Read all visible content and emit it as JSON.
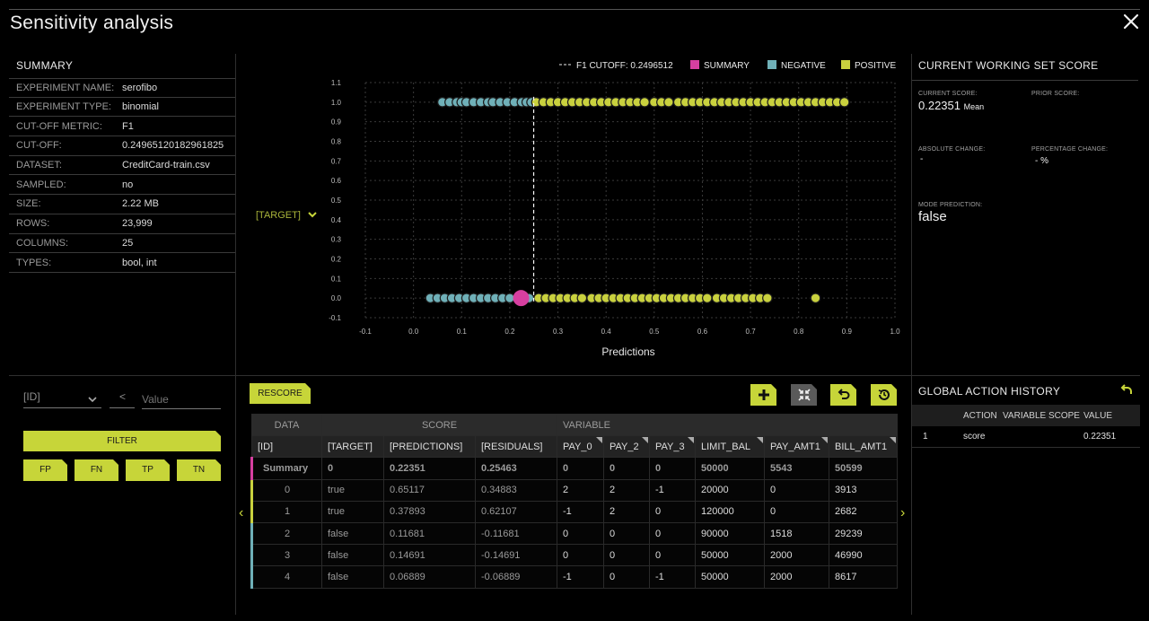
{
  "title": "Sensitivity analysis",
  "summary": {
    "heading": "SUMMARY",
    "rows": [
      {
        "key": "EXPERIMENT NAME:",
        "val": "serofibo"
      },
      {
        "key": "EXPERIMENT TYPE:",
        "val": "binomial"
      },
      {
        "key": "CUT-OFF METRIC:",
        "val": "F1"
      },
      {
        "key": "CUT-OFF:",
        "val": "0.24965120182961825"
      },
      {
        "key": "DATASET:",
        "val": "CreditCard-train.csv"
      },
      {
        "key": "SAMPLED:",
        "val": "no"
      },
      {
        "key": "SIZE:",
        "val": "2.22 MB"
      },
      {
        "key": "ROWS:",
        "val": "23,999"
      },
      {
        "key": "COLUMNS:",
        "val": "25"
      },
      {
        "key": "TYPES:",
        "val": "bool, int"
      }
    ]
  },
  "chart_data": {
    "type": "scatter",
    "xlabel": "Predictions",
    "ylabel_select": "[TARGET]",
    "xlim": [
      -0.1,
      1.0
    ],
    "ylim": [
      -0.1,
      1.1
    ],
    "xticks": [
      "-0.1",
      "0.0",
      "0.1",
      "0.2",
      "0.3",
      "0.4",
      "0.5",
      "0.6",
      "0.7",
      "0.8",
      "0.9",
      "1.0"
    ],
    "yticks": [
      "-0.1",
      "0.0",
      "0.1",
      "0.2",
      "0.3",
      "0.4",
      "0.5",
      "0.6",
      "0.7",
      "0.8",
      "0.9",
      "1.0",
      "1.1"
    ],
    "cutoff": 0.2496512,
    "legend": {
      "cutoff": "F1 CUTOFF: 0.2496512",
      "summary": "SUMMARY",
      "negative": "NEGATIVE",
      "positive": "POSITIVE"
    },
    "colors": {
      "summary": "#d63fa0",
      "negative": "#6fb0b8",
      "positive": "#c9d13e"
    },
    "summary_point": {
      "x": 0.2235,
      "y": 0.0
    },
    "series": [
      {
        "name": "NEGATIVE",
        "y": 1.0,
        "x": [
          0.06,
          0.075,
          0.09,
          0.1,
          0.11,
          0.125,
          0.14,
          0.155,
          0.165,
          0.18,
          0.195,
          0.21,
          0.225,
          0.235,
          0.245
        ]
      },
      {
        "name": "POSITIVE",
        "y": 1.0,
        "x": [
          0.255,
          0.27,
          0.285,
          0.3,
          0.315,
          0.33,
          0.345,
          0.36,
          0.375,
          0.39,
          0.405,
          0.42,
          0.435,
          0.45,
          0.465,
          0.48,
          0.5,
          0.515,
          0.53,
          0.55,
          0.565,
          0.58,
          0.595,
          0.61,
          0.625,
          0.64,
          0.655,
          0.67,
          0.685,
          0.7,
          0.715,
          0.73,
          0.745,
          0.76,
          0.775,
          0.79,
          0.805,
          0.82,
          0.835,
          0.85,
          0.865,
          0.88,
          0.895
        ]
      },
      {
        "name": "NEGATIVE",
        "y": 0.0,
        "x": [
          0.035,
          0.05,
          0.065,
          0.08,
          0.095,
          0.11,
          0.125,
          0.14,
          0.155,
          0.17,
          0.185,
          0.2,
          0.24
        ]
      },
      {
        "name": "POSITIVE",
        "y": 0.0,
        "x": [
          0.26,
          0.275,
          0.29,
          0.305,
          0.32,
          0.335,
          0.35,
          0.37,
          0.385,
          0.4,
          0.415,
          0.43,
          0.445,
          0.46,
          0.475,
          0.49,
          0.505,
          0.52,
          0.535,
          0.55,
          0.565,
          0.58,
          0.595,
          0.61,
          0.63,
          0.645,
          0.66,
          0.675,
          0.69,
          0.705,
          0.72,
          0.735,
          0.835
        ]
      }
    ]
  },
  "score": {
    "heading": "CURRENT WORKING SET SCORE",
    "current_label": "CURRENT SCORE:",
    "current_value": "0.22351",
    "current_unit": "Mean",
    "prior_label": "PRIOR SCORE:",
    "abs_label": "ABSOLUTE CHANGE:",
    "abs_value": "-",
    "pct_label": "PERCENTAGE CHANGE:",
    "pct_value": "- %",
    "mode_label": "MODE PREDICTION:",
    "mode_value": "false"
  },
  "filter": {
    "column": "[ID]",
    "operator": "<",
    "value_placeholder": "Value",
    "filter_label": "FILTER",
    "fp": "FP",
    "fn": "FN",
    "tp": "TP",
    "tn": "TN"
  },
  "toolbar": {
    "rescore": "RESCORE"
  },
  "table": {
    "groups": {
      "data": "DATA",
      "score": "SCORE",
      "variable": "VARIABLE"
    },
    "columns": [
      "[ID]",
      "[TARGET]",
      "[PREDICTIONS]",
      "[RESIDUALS]",
      "PAY_0",
      "PAY_2",
      "PAY_3",
      "LIMIT_BAL",
      "PAY_AMT1",
      "BILL_AMT1"
    ],
    "rows": [
      [
        "Summary",
        "0",
        "0.22351",
        "0.25463",
        "0",
        "0",
        "0",
        "50000",
        "5543",
        "50599"
      ],
      [
        "0",
        "true",
        "0.65117",
        "0.34883",
        "2",
        "2",
        "-1",
        "20000",
        "0",
        "3913"
      ],
      [
        "1",
        "true",
        "0.37893",
        "0.62107",
        "-1",
        "2",
        "0",
        "120000",
        "0",
        "2682"
      ],
      [
        "2",
        "false",
        "0.11681",
        "-0.11681",
        "0",
        "0",
        "0",
        "90000",
        "1518",
        "29239"
      ],
      [
        "3",
        "false",
        "0.14691",
        "-0.14691",
        "0",
        "0",
        "0",
        "50000",
        "2000",
        "46990"
      ],
      [
        "4",
        "false",
        "0.06889",
        "-0.06889",
        "-1",
        "0",
        "-1",
        "50000",
        "2000",
        "8617"
      ]
    ],
    "row_colors": [
      "#d63fa0",
      "#c9d13e",
      "#c9d13e",
      "#6fb0b8",
      "#6fb0b8",
      "#6fb0b8"
    ]
  },
  "history": {
    "heading": "GLOBAL ACTION HISTORY",
    "cols": {
      "action": "ACTION",
      "scope": "VARIABLE SCOPE",
      "value": "VALUE"
    },
    "rows": [
      {
        "n": "1",
        "action": "score",
        "scope": "",
        "value": "0.22351"
      }
    ]
  }
}
